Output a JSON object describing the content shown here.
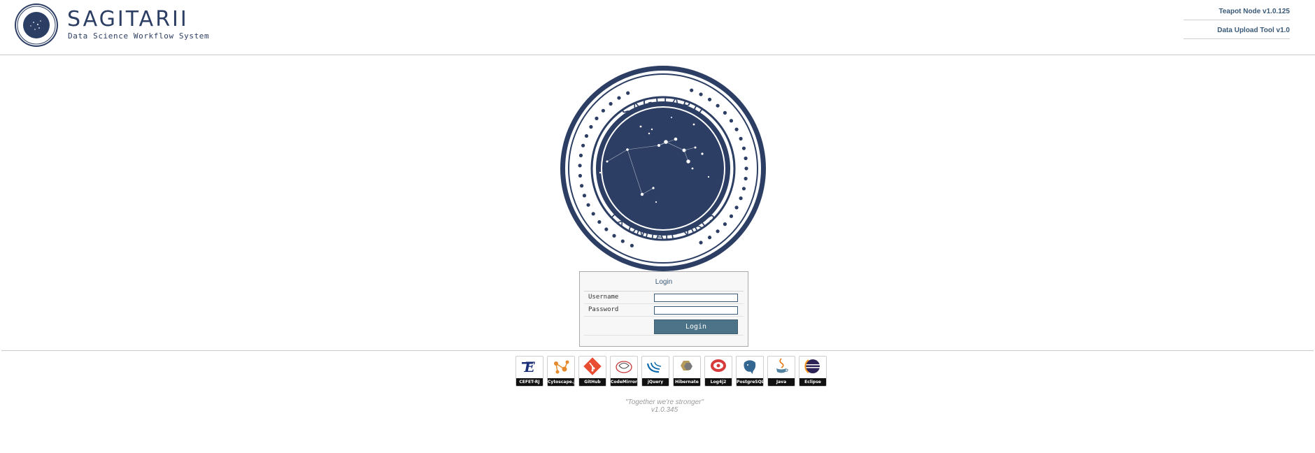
{
  "header": {
    "brand_title": "SAGITARII",
    "brand_subtitle": "Data Science Workflow System",
    "links": [
      {
        "label": "Teapot Node v1.0.125"
      },
      {
        "label": "Data Upload Tool v1.0"
      }
    ]
  },
  "seal": {
    "top_text": "SAGITARII",
    "bottom_text": "EX UNITATE VIRES"
  },
  "login": {
    "title": "Login",
    "username_label": "Username",
    "password_label": "Password",
    "username_value": "",
    "password_value": "",
    "button_label": "Login"
  },
  "technologies": [
    {
      "name": "CEFET-RJ",
      "icon": "cefet-logo-icon"
    },
    {
      "name": "Cytoscape.js",
      "icon": "cytoscape-logo-icon"
    },
    {
      "name": "GitHub",
      "icon": "git-logo-icon"
    },
    {
      "name": "CodeMirror",
      "icon": "codemirror-logo-icon"
    },
    {
      "name": "jQuery",
      "icon": "jquery-logo-icon"
    },
    {
      "name": "Hibernate",
      "icon": "hibernate-logo-icon"
    },
    {
      "name": "Log4j2",
      "icon": "log4j-logo-icon"
    },
    {
      "name": "PostgreSQL",
      "icon": "postgresql-logo-icon"
    },
    {
      "name": "Java",
      "icon": "java-logo-icon"
    },
    {
      "name": "Eclipse",
      "icon": "eclipse-logo-icon"
    }
  ],
  "footer": {
    "motto": "\"Together we're stronger\"",
    "version": "v1.0.345"
  },
  "colors": {
    "brand_navy": "#2c3e63",
    "link_blue": "#3a5a78",
    "button": "#4d7388"
  }
}
